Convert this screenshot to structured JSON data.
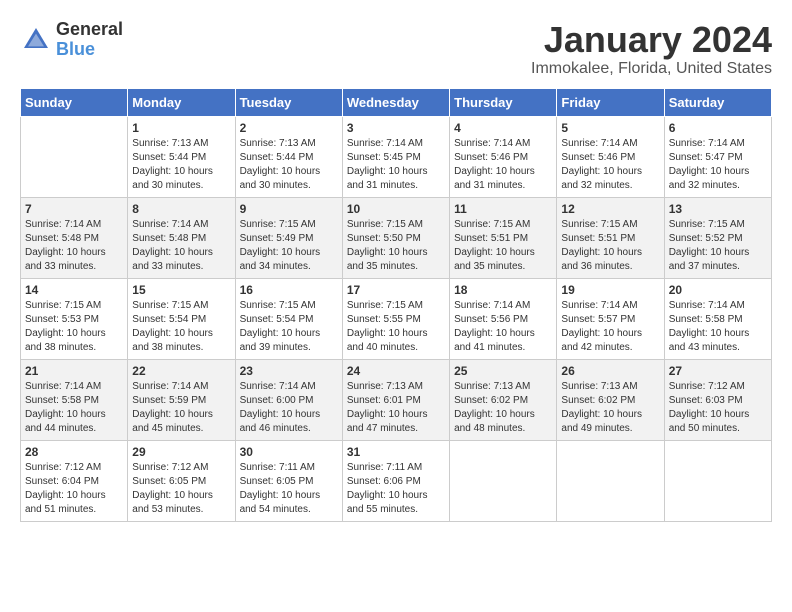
{
  "logo": {
    "general": "General",
    "blue": "Blue"
  },
  "header": {
    "month": "January 2024",
    "location": "Immokalee, Florida, United States"
  },
  "weekdays": [
    "Sunday",
    "Monday",
    "Tuesday",
    "Wednesday",
    "Thursday",
    "Friday",
    "Saturday"
  ],
  "weeks": [
    [
      {
        "day": "",
        "sunrise": "",
        "sunset": "",
        "daylight": ""
      },
      {
        "day": "1",
        "sunrise": "Sunrise: 7:13 AM",
        "sunset": "Sunset: 5:44 PM",
        "daylight": "Daylight: 10 hours and 30 minutes."
      },
      {
        "day": "2",
        "sunrise": "Sunrise: 7:13 AM",
        "sunset": "Sunset: 5:44 PM",
        "daylight": "Daylight: 10 hours and 30 minutes."
      },
      {
        "day": "3",
        "sunrise": "Sunrise: 7:14 AM",
        "sunset": "Sunset: 5:45 PM",
        "daylight": "Daylight: 10 hours and 31 minutes."
      },
      {
        "day": "4",
        "sunrise": "Sunrise: 7:14 AM",
        "sunset": "Sunset: 5:46 PM",
        "daylight": "Daylight: 10 hours and 31 minutes."
      },
      {
        "day": "5",
        "sunrise": "Sunrise: 7:14 AM",
        "sunset": "Sunset: 5:46 PM",
        "daylight": "Daylight: 10 hours and 32 minutes."
      },
      {
        "day": "6",
        "sunrise": "Sunrise: 7:14 AM",
        "sunset": "Sunset: 5:47 PM",
        "daylight": "Daylight: 10 hours and 32 minutes."
      }
    ],
    [
      {
        "day": "7",
        "sunrise": "Sunrise: 7:14 AM",
        "sunset": "Sunset: 5:48 PM",
        "daylight": "Daylight: 10 hours and 33 minutes."
      },
      {
        "day": "8",
        "sunrise": "Sunrise: 7:14 AM",
        "sunset": "Sunset: 5:48 PM",
        "daylight": "Daylight: 10 hours and 33 minutes."
      },
      {
        "day": "9",
        "sunrise": "Sunrise: 7:15 AM",
        "sunset": "Sunset: 5:49 PM",
        "daylight": "Daylight: 10 hours and 34 minutes."
      },
      {
        "day": "10",
        "sunrise": "Sunrise: 7:15 AM",
        "sunset": "Sunset: 5:50 PM",
        "daylight": "Daylight: 10 hours and 35 minutes."
      },
      {
        "day": "11",
        "sunrise": "Sunrise: 7:15 AM",
        "sunset": "Sunset: 5:51 PM",
        "daylight": "Daylight: 10 hours and 35 minutes."
      },
      {
        "day": "12",
        "sunrise": "Sunrise: 7:15 AM",
        "sunset": "Sunset: 5:51 PM",
        "daylight": "Daylight: 10 hours and 36 minutes."
      },
      {
        "day": "13",
        "sunrise": "Sunrise: 7:15 AM",
        "sunset": "Sunset: 5:52 PM",
        "daylight": "Daylight: 10 hours and 37 minutes."
      }
    ],
    [
      {
        "day": "14",
        "sunrise": "Sunrise: 7:15 AM",
        "sunset": "Sunset: 5:53 PM",
        "daylight": "Daylight: 10 hours and 38 minutes."
      },
      {
        "day": "15",
        "sunrise": "Sunrise: 7:15 AM",
        "sunset": "Sunset: 5:54 PM",
        "daylight": "Daylight: 10 hours and 38 minutes."
      },
      {
        "day": "16",
        "sunrise": "Sunrise: 7:15 AM",
        "sunset": "Sunset: 5:54 PM",
        "daylight": "Daylight: 10 hours and 39 minutes."
      },
      {
        "day": "17",
        "sunrise": "Sunrise: 7:15 AM",
        "sunset": "Sunset: 5:55 PM",
        "daylight": "Daylight: 10 hours and 40 minutes."
      },
      {
        "day": "18",
        "sunrise": "Sunrise: 7:14 AM",
        "sunset": "Sunset: 5:56 PM",
        "daylight": "Daylight: 10 hours and 41 minutes."
      },
      {
        "day": "19",
        "sunrise": "Sunrise: 7:14 AM",
        "sunset": "Sunset: 5:57 PM",
        "daylight": "Daylight: 10 hours and 42 minutes."
      },
      {
        "day": "20",
        "sunrise": "Sunrise: 7:14 AM",
        "sunset": "Sunset: 5:58 PM",
        "daylight": "Daylight: 10 hours and 43 minutes."
      }
    ],
    [
      {
        "day": "21",
        "sunrise": "Sunrise: 7:14 AM",
        "sunset": "Sunset: 5:58 PM",
        "daylight": "Daylight: 10 hours and 44 minutes."
      },
      {
        "day": "22",
        "sunrise": "Sunrise: 7:14 AM",
        "sunset": "Sunset: 5:59 PM",
        "daylight": "Daylight: 10 hours and 45 minutes."
      },
      {
        "day": "23",
        "sunrise": "Sunrise: 7:14 AM",
        "sunset": "Sunset: 6:00 PM",
        "daylight": "Daylight: 10 hours and 46 minutes."
      },
      {
        "day": "24",
        "sunrise": "Sunrise: 7:13 AM",
        "sunset": "Sunset: 6:01 PM",
        "daylight": "Daylight: 10 hours and 47 minutes."
      },
      {
        "day": "25",
        "sunrise": "Sunrise: 7:13 AM",
        "sunset": "Sunset: 6:02 PM",
        "daylight": "Daylight: 10 hours and 48 minutes."
      },
      {
        "day": "26",
        "sunrise": "Sunrise: 7:13 AM",
        "sunset": "Sunset: 6:02 PM",
        "daylight": "Daylight: 10 hours and 49 minutes."
      },
      {
        "day": "27",
        "sunrise": "Sunrise: 7:12 AM",
        "sunset": "Sunset: 6:03 PM",
        "daylight": "Daylight: 10 hours and 50 minutes."
      }
    ],
    [
      {
        "day": "28",
        "sunrise": "Sunrise: 7:12 AM",
        "sunset": "Sunset: 6:04 PM",
        "daylight": "Daylight: 10 hours and 51 minutes."
      },
      {
        "day": "29",
        "sunrise": "Sunrise: 7:12 AM",
        "sunset": "Sunset: 6:05 PM",
        "daylight": "Daylight: 10 hours and 53 minutes."
      },
      {
        "day": "30",
        "sunrise": "Sunrise: 7:11 AM",
        "sunset": "Sunset: 6:05 PM",
        "daylight": "Daylight: 10 hours and 54 minutes."
      },
      {
        "day": "31",
        "sunrise": "Sunrise: 7:11 AM",
        "sunset": "Sunset: 6:06 PM",
        "daylight": "Daylight: 10 hours and 55 minutes."
      },
      {
        "day": "",
        "sunrise": "",
        "sunset": "",
        "daylight": ""
      },
      {
        "day": "",
        "sunrise": "",
        "sunset": "",
        "daylight": ""
      },
      {
        "day": "",
        "sunrise": "",
        "sunset": "",
        "daylight": ""
      }
    ]
  ]
}
